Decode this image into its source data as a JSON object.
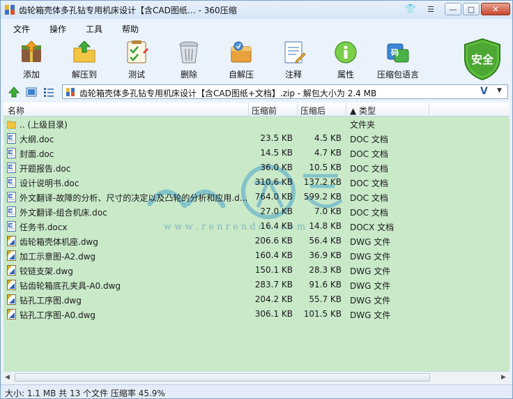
{
  "window": {
    "title": "齿轮箱壳体多孔钻专用机床设计【含CAD图纸… - 360压缩"
  },
  "menu": [
    "文件",
    "操作",
    "工具",
    "帮助"
  ],
  "toolbar": {
    "items": [
      {
        "label": "添加",
        "icon": "add-archive-icon"
      },
      {
        "label": "解压到",
        "icon": "extract-folder-icon"
      },
      {
        "label": "测试",
        "icon": "test-checklist-icon"
      },
      {
        "label": "删除",
        "icon": "trash-can-icon"
      },
      {
        "label": "自解压",
        "icon": "self-extract-icon"
      },
      {
        "label": "注释",
        "icon": "comment-note-icon"
      },
      {
        "label": "属性",
        "icon": "info-icon"
      },
      {
        "label": "压缩包语言",
        "icon": "code-language-icon"
      }
    ],
    "security_label": "安全"
  },
  "address": {
    "path": "齿轮箱壳体多孔钻专用机床设计【含CAD图纸+文档】.zip - 解包大小为 2.4 MB",
    "v_symbol": "V",
    "dropdown_symbol": "▼"
  },
  "columns": {
    "name": "名称",
    "size": "压缩前",
    "compressed": "压缩后",
    "type": "▲ 类型"
  },
  "files": [
    {
      "name": ".. (上级目录)",
      "size": "",
      "compressed": "",
      "type": "文件夹",
      "kind": "folder"
    },
    {
      "name": "大纲.doc",
      "size": "23.5 KB",
      "compressed": "4.5 KB",
      "type": "DOC 文档",
      "kind": "doc"
    },
    {
      "name": "封面.doc",
      "size": "14.5 KB",
      "compressed": "4.7 KB",
      "type": "DOC 文档",
      "kind": "doc"
    },
    {
      "name": "开题报告.doc",
      "size": "36.0 KB",
      "compressed": "10.5 KB",
      "type": "DOC 文档",
      "kind": "doc"
    },
    {
      "name": "设计说明书.doc",
      "size": "310.6 KB",
      "compressed": "137.2 KB",
      "type": "DOC 文档",
      "kind": "doc"
    },
    {
      "name": "外文翻译-故障的分析、尺寸的决定以及凸轮的分析和应用.d...",
      "size": "764.0 KB",
      "compressed": "599.2 KB",
      "type": "DOC 文档",
      "kind": "doc"
    },
    {
      "name": "外文翻译-组合机床.doc",
      "size": "27.0 KB",
      "compressed": "7.0 KB",
      "type": "DOC 文档",
      "kind": "doc"
    },
    {
      "name": "任务书.docx",
      "size": "16.4 KB",
      "compressed": "14.8 KB",
      "type": "DOCX 文档",
      "kind": "doc"
    },
    {
      "name": "齿轮箱壳体机座.dwg",
      "size": "206.6 KB",
      "compressed": "56.4 KB",
      "type": "DWG 文件",
      "kind": "dwg"
    },
    {
      "name": "加工示意图-A2.dwg",
      "size": "160.4 KB",
      "compressed": "36.9 KB",
      "type": "DWG 文件",
      "kind": "dwg"
    },
    {
      "name": "铰链支架.dwg",
      "size": "150.1 KB",
      "compressed": "28.3 KB",
      "type": "DWG 文件",
      "kind": "dwg"
    },
    {
      "name": "钻齿轮箱底孔夹具-A0.dwg",
      "size": "283.7 KB",
      "compressed": "91.6 KB",
      "type": "DWG 文件",
      "kind": "dwg"
    },
    {
      "name": "钻孔工序图.dwg",
      "size": "204.2 KB",
      "compressed": "55.7 KB",
      "type": "DWG 文件",
      "kind": "dwg"
    },
    {
      "name": "钻孔工序图-A0.dwg",
      "size": "306.1 KB",
      "compressed": "101.5 KB",
      "type": "DWG 文件",
      "kind": "dwg"
    }
  ],
  "watermark": {
    "url": "w w w . r e n r e n d o c . c o m"
  },
  "status": {
    "text": "大小: 1.1 MB 共 13 个文件 压缩率 45.9%"
  },
  "colors": {
    "list_background": "#c9e9c9",
    "window_background": "#eaf2fb",
    "shield_green": "#4caf3c",
    "close_red": "#c8462e"
  }
}
